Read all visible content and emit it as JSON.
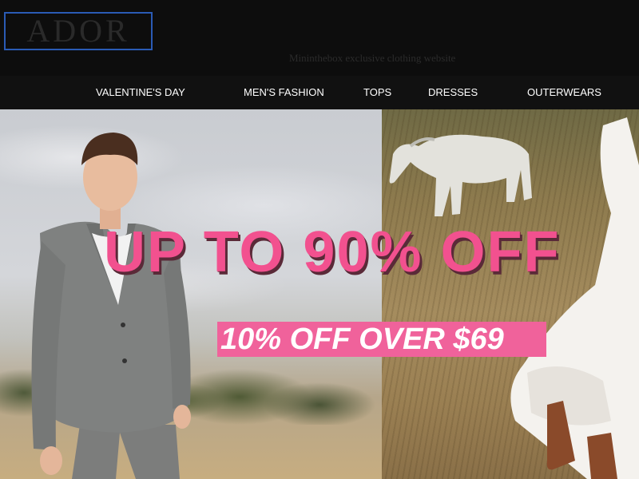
{
  "header": {
    "logo_text": "ADOR",
    "tagline": "Mininthebox exclusive clothing website"
  },
  "nav": {
    "items": [
      {
        "label": "VALENTINE'S DAY"
      },
      {
        "label": "MEN'S FASHION"
      },
      {
        "label": "TOPS"
      },
      {
        "label": "DRESSES"
      },
      {
        "label": "OUTERWEARS"
      }
    ]
  },
  "banner": {
    "headline": "UP TO 90% OFF",
    "promo": "10% OFF OVER $69"
  },
  "colors": {
    "background": "#0d0d0d",
    "logo_border": "#2a5bb5",
    "headline_pink": "#f2518f",
    "promo_strip": "#f0629b"
  }
}
